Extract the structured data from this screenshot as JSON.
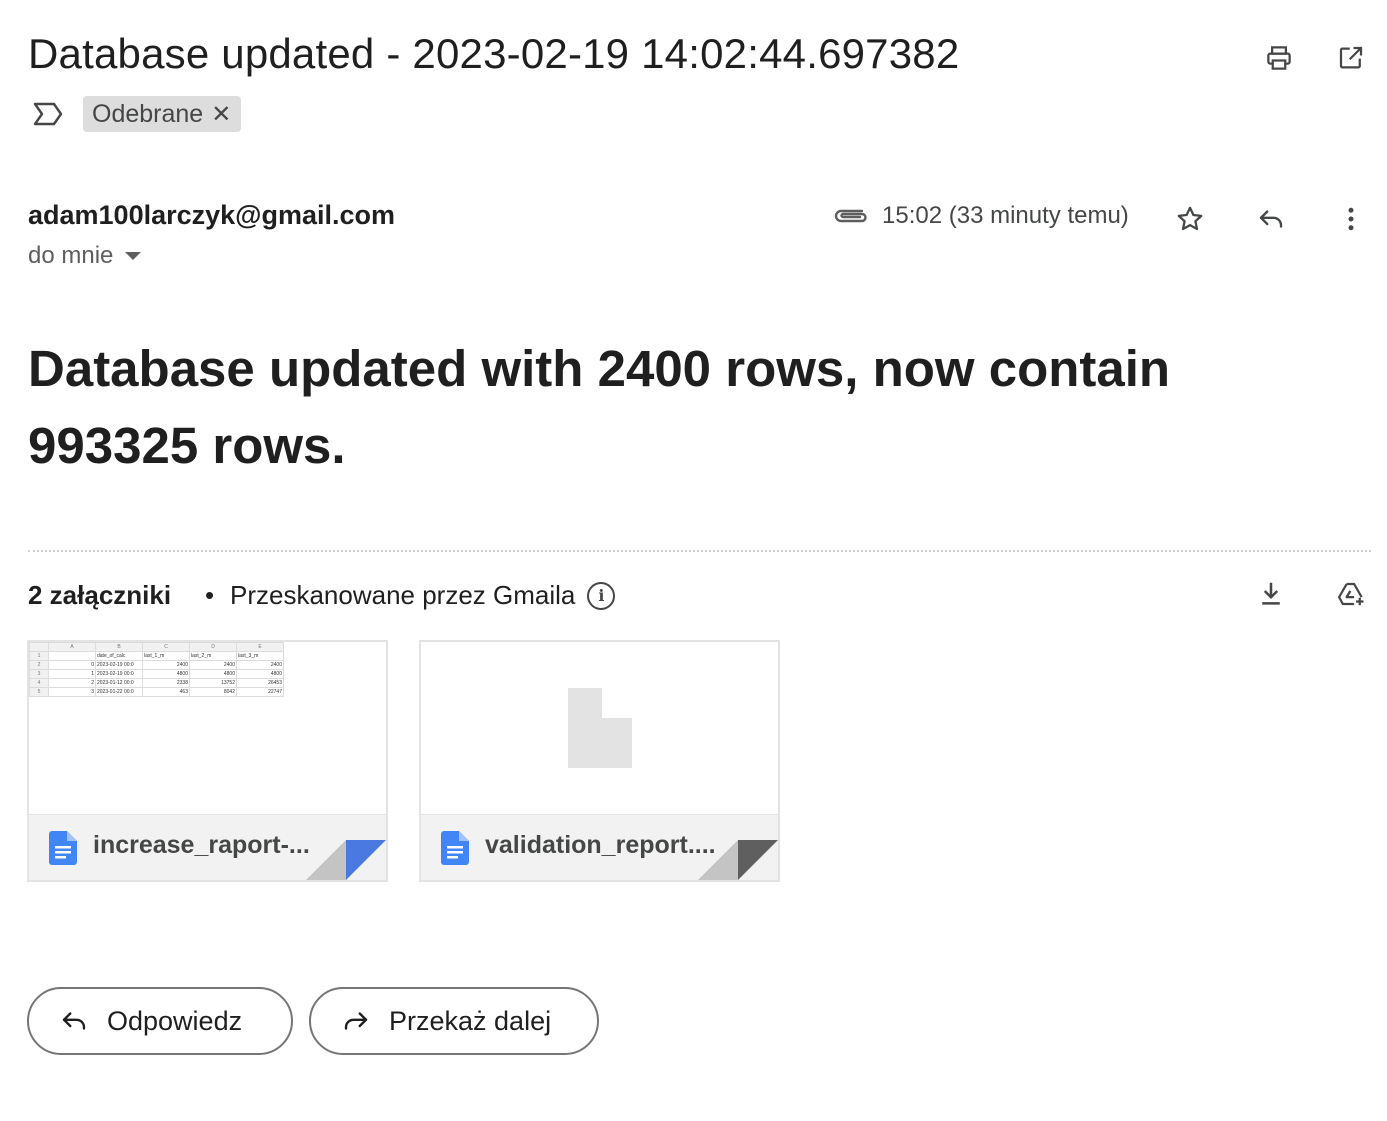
{
  "email": {
    "subject": "Database updated - 2023-02-19 14:02:44.697382",
    "label": "Odebrane",
    "sender": "adam100larczyk@gmail.com",
    "recipient": "do mnie",
    "time": "15:02 (33 minuty temu)",
    "body": "Database updated with 2400 rows, now contain 993325 rows."
  },
  "attachments": {
    "count_label": "2 załączniki",
    "separator": "•",
    "scanned_label": "Przeskanowane przez Gmaila",
    "files": [
      {
        "name": "increase_raport-...",
        "accent": "#4a7ae0",
        "preview": {
          "columns": [
            "A",
            "B",
            "C",
            "D",
            "E"
          ],
          "rows": [
            [
              "1",
              "",
              "date_of_calc",
              "last_1_m",
              "last_2_m",
              "last_3_m"
            ],
            [
              "2",
              "0",
              "2023-02-19 00:0",
              "2400",
              "2400",
              "2400"
            ],
            [
              "3",
              "1",
              "2023-02-19 00:0",
              "4800",
              "4800",
              "4800"
            ],
            [
              "4",
              "2",
              "2023-01-12 00:0",
              "2338",
              "13752",
              "26453"
            ],
            [
              "5",
              "3",
              "2023-01-22 00:0",
              "463",
              "8042",
              "22747"
            ]
          ]
        }
      },
      {
        "name": "validation_report....",
        "accent": "#5f5f5f"
      }
    ]
  },
  "actions": {
    "reply": "Odpowiedz",
    "forward": "Przekaż dalej"
  },
  "colors": {
    "doc_icon": "#4285f4",
    "chip_bg": "#dddddd",
    "text": "#1f1f1f"
  }
}
